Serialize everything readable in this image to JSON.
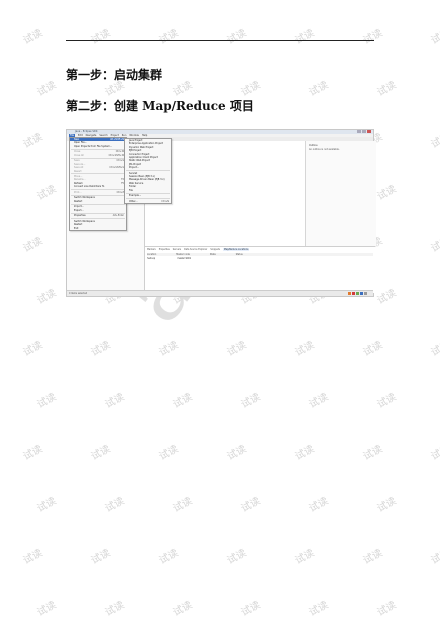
{
  "page": {
    "step1": "第一步：启动集群",
    "step2": "第二步：创建 Map/Reduce 项目",
    "watermark_text": "试读",
    "big_watermark": "aste"
  },
  "screenshot": {
    "title": "Java - Eclipse SDK",
    "menubar": [
      "File",
      "Edit",
      "Navigate",
      "Search",
      "Project",
      "Run",
      "Window",
      "Help"
    ],
    "file_menu": [
      {
        "label": "New",
        "shortcut": "Alt+Shift+N",
        "hl": true
      },
      {
        "label": "Open File...",
        "shortcut": ""
      },
      {
        "label": "Open Projects from File System...",
        "shortcut": ""
      },
      {
        "sep": true
      },
      {
        "label": "Close",
        "shortcut": "Ctrl+W",
        "dis": true
      },
      {
        "label": "Close All",
        "shortcut": "Ctrl+Shift+W",
        "dis": true
      },
      {
        "sep": true
      },
      {
        "label": "Save",
        "shortcut": "Ctrl+S",
        "dis": true
      },
      {
        "label": "Save As...",
        "shortcut": "",
        "dis": true
      },
      {
        "label": "Save All",
        "shortcut": "Ctrl+Shift+S",
        "dis": true
      },
      {
        "label": "Revert",
        "shortcut": "",
        "dis": true
      },
      {
        "sep": true
      },
      {
        "label": "Move...",
        "shortcut": "",
        "dis": true
      },
      {
        "label": "Rename...",
        "shortcut": "F2",
        "dis": true
      },
      {
        "label": "Refresh",
        "shortcut": "F5"
      },
      {
        "label": "Convert Line Delimiters To",
        "shortcut": ""
      },
      {
        "sep": true
      },
      {
        "label": "Print...",
        "shortcut": "Ctrl+P",
        "dis": true
      },
      {
        "sep": true
      },
      {
        "label": "Switch Workspace",
        "shortcut": ""
      },
      {
        "label": "Restart",
        "shortcut": ""
      },
      {
        "sep": true
      },
      {
        "label": "Import...",
        "shortcut": ""
      },
      {
        "label": "Export...",
        "shortcut": ""
      },
      {
        "sep": true
      },
      {
        "label": "Properties",
        "shortcut": "Alt+Enter"
      },
      {
        "sep": true
      },
      {
        "label": "Switch Workspace",
        "shortcut": ""
      },
      {
        "label": "Restart",
        "shortcut": ""
      },
      {
        "label": "Exit",
        "shortcut": ""
      }
    ],
    "new_submenu": [
      {
        "label": "Java Project",
        "shortcut": ""
      },
      {
        "label": "Enterprise Application Project",
        "shortcut": ""
      },
      {
        "label": "Dynamic Web Project",
        "shortcut": ""
      },
      {
        "label": "EJB Project",
        "shortcut": ""
      },
      {
        "label": "Connector Project",
        "shortcut": ""
      },
      {
        "label": "Application Client Project",
        "shortcut": ""
      },
      {
        "label": "Static Web Project",
        "shortcut": ""
      },
      {
        "label": "JPA Project",
        "shortcut": ""
      },
      {
        "label": "Project...",
        "shortcut": ""
      },
      {
        "sep": true
      },
      {
        "label": "Servlet",
        "shortcut": ""
      },
      {
        "label": "Session Bean (EJB 3.x)",
        "shortcut": ""
      },
      {
        "label": "Message-Driven Bean (EJB 3.x)",
        "shortcut": ""
      },
      {
        "label": "Web Service",
        "shortcut": ""
      },
      {
        "label": "Folder",
        "shortcut": ""
      },
      {
        "label": "File",
        "shortcut": ""
      },
      {
        "sep": true
      },
      {
        "label": "Example...",
        "shortcut": ""
      },
      {
        "sep": true
      },
      {
        "label": "Other...",
        "shortcut": "Ctrl+N"
      }
    ],
    "outline_title": "Outline",
    "outline_message": "An outline is not available.",
    "bottom_tabs": [
      "Markers",
      "Properties",
      "Servers",
      "Data Source Explorer",
      "Snippets",
      "Map/Reduce Locations"
    ],
    "bottom_columns": [
      "Location",
      "Master node",
      "State",
      "Status"
    ],
    "bottom_row": [
      "hadoop",
      "master:9001",
      "",
      ""
    ],
    "status_left": "0 items selected",
    "tray_colors": [
      "#e07a2f",
      "#d33c3c",
      "#6aa84f",
      "#3b6fbf",
      "#999999"
    ]
  }
}
